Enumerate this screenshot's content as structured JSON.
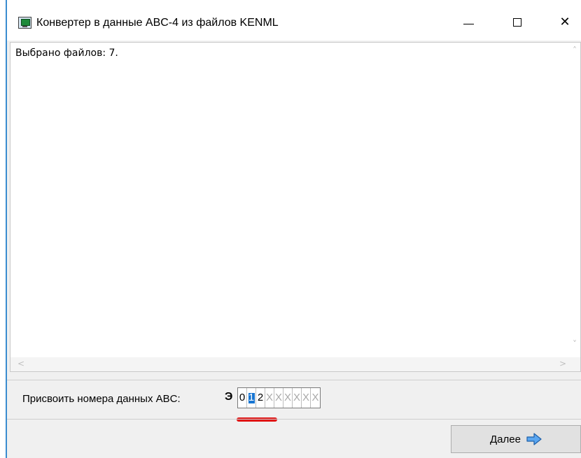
{
  "window": {
    "title": "Конвертер в данные ABC-4 из файлов KENML",
    "icon": "computer-icon",
    "controls": {
      "minimize_icon": "minimize-icon",
      "maximize_icon": "maximize-icon",
      "close_icon": "close-icon",
      "close_glyph": "✕"
    }
  },
  "log": {
    "text": "Выбрано файлов: 7.",
    "scroll_up_glyph": "˄",
    "scroll_down_glyph": "˅",
    "scroll_left_glyph": "<",
    "scroll_right_glyph": ">"
  },
  "assign": {
    "label": "Присвоить номера данных ABC:",
    "prefix": "Э",
    "digits": [
      "0",
      "1",
      "2",
      "X",
      "X",
      "X",
      "X",
      "X",
      "X"
    ],
    "selected_index": 1
  },
  "next_button": {
    "label": "Далее",
    "icon": "arrow-right-icon"
  },
  "colors": {
    "accent": "#1976d2",
    "annotation_red": "#e01515",
    "arrow_fill": "#5aa6f0"
  }
}
